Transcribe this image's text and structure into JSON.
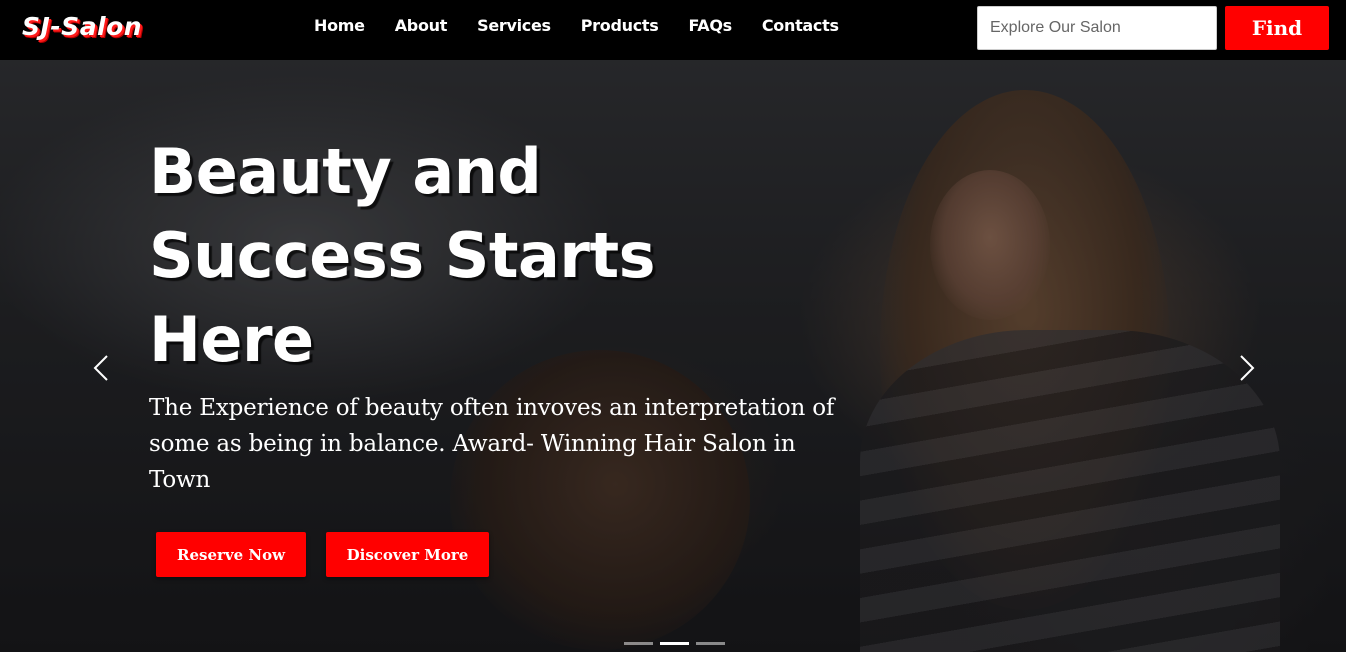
{
  "navbar": {
    "brand": "SJ-Salon",
    "links": [
      "Home",
      "About",
      "Services",
      "Products",
      "FAQs",
      "Contacts"
    ],
    "search": {
      "placeholder": "Explore Our Salon",
      "value": ""
    },
    "find_label": "Find"
  },
  "hero": {
    "title": "Beauty and Success Starts Here",
    "subtitle": "The Experience of beauty often invoves an interpretation of some as being in balance. Award- Winning Hair Salon in Town",
    "reserve_label": "Reserve Now",
    "discover_label": "Discover More",
    "slides": {
      "count": 3,
      "active_index": 1
    }
  },
  "colors": {
    "accent": "#ff0000",
    "navbar_bg": "#000000",
    "text": "#ffffff"
  },
  "icons": {
    "prev": "chevron-left-icon",
    "next": "chevron-right-icon"
  }
}
